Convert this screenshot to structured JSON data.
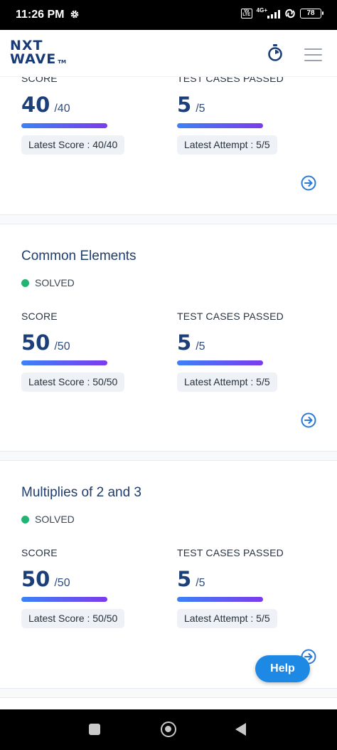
{
  "status_bar": {
    "time": "11:26 PM",
    "volte": "Vo LTE",
    "network": "4G+",
    "battery": "78"
  },
  "header": {
    "logo_line1": "NXT",
    "logo_line2": "WAVE",
    "logo_tm": "TM"
  },
  "cards": [
    {
      "title": "",
      "status": "",
      "score_label": "SCORE",
      "score": "40",
      "score_total": "/40",
      "tests_label": "TEST CASES PASSED",
      "tests": "5",
      "tests_total": "/5",
      "latest_score": "Latest Score : 40/40",
      "latest_attempt": "Latest Attempt : 5/5"
    },
    {
      "title": "Common Elements",
      "status": "SOLVED",
      "score_label": "SCORE",
      "score": "50",
      "score_total": "/50",
      "tests_label": "TEST CASES PASSED",
      "tests": "5",
      "tests_total": "/5",
      "latest_score": "Latest Score : 50/50",
      "latest_attempt": "Latest Attempt : 5/5"
    },
    {
      "title": "Multiplies of 2 and 3",
      "status": "SOLVED",
      "score_label": "SCORE",
      "score": "50",
      "score_total": "/50",
      "tests_label": "TEST CASES PASSED",
      "tests": "5",
      "tests_total": "/5",
      "latest_score": "Latest Score : 50/50",
      "latest_attempt": "Latest Attempt : 5/5"
    }
  ],
  "help_label": "Help",
  "colors": {
    "brand": "#183b78",
    "solved": "#21b574",
    "help": "#1e88e5",
    "progress_start": "#3b82f6",
    "progress_end": "#7c3aed"
  }
}
